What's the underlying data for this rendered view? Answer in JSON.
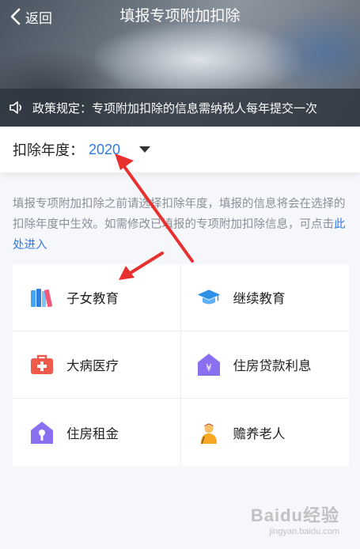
{
  "header": {
    "back_label": "返回",
    "title": "填报专项附加扣除"
  },
  "notice": {
    "text": "政策规定：专项附加扣除的信息需纳税人每年提交一次"
  },
  "year_selector": {
    "label": "扣除年度：",
    "value": "2020"
  },
  "description": {
    "text": "填报专项附加扣除之前请选择扣除年度，填报的信息将会在选择的扣除年度中生效。如需修改已填报的专项附加扣除信息，可点击",
    "link": "此处进入"
  },
  "deductions": [
    {
      "label": "子女教育",
      "icon": "books-icon",
      "color": "#3aa0f0"
    },
    {
      "label": "继续教育",
      "icon": "graduation-cap-icon",
      "color": "#2d8fe6"
    },
    {
      "label": "大病医疗",
      "icon": "medical-kit-icon",
      "color": "#f05a4a"
    },
    {
      "label": "住房贷款利息",
      "icon": "house-yuan-icon",
      "color": "#8a6ff0"
    },
    {
      "label": "住房租金",
      "icon": "house-key-icon",
      "color": "#8a6ff0"
    },
    {
      "label": "赡养老人",
      "icon": "elder-person-icon",
      "color": "#f5a623"
    }
  ],
  "watermark": {
    "line1": "Baidu经验",
    "line2": "jingyan.baidu.com"
  },
  "colors": {
    "accent": "#2f7ae5",
    "annotation_arrow": "#e8312f"
  }
}
